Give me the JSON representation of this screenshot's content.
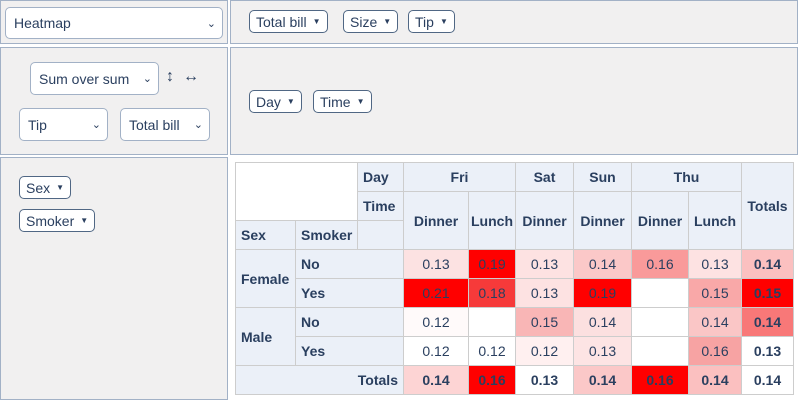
{
  "renderer": {
    "selected": "Heatmap"
  },
  "aggregator": {
    "selected": "Sum over sum",
    "arg1": "Tip",
    "arg2": "Total bill",
    "row_order_icon": "↕",
    "col_order_icon": "↔"
  },
  "unused_attrs": [
    "Total bill",
    "Size",
    "Tip"
  ],
  "col_attrs": [
    "Day",
    "Time"
  ],
  "row_attrs": [
    "Sex",
    "Smoker"
  ],
  "table": {
    "day_label": "Day",
    "time_label": "Time",
    "sex_label": "Sex",
    "smoker_label": "Smoker",
    "totals_label": "Totals",
    "days": [
      "Fri",
      "Sat",
      "Sun",
      "Thu"
    ],
    "times": [
      "Dinner",
      "Lunch",
      "Dinner",
      "Dinner",
      "Dinner",
      "Lunch"
    ],
    "sexes": [
      "Female",
      "Male"
    ],
    "smokers": [
      "No",
      "Yes",
      "No",
      "Yes"
    ],
    "rows": [
      {
        "values": [
          "0.13",
          "0.19",
          "0.13",
          "0.14",
          "0.16",
          "0.13"
        ],
        "total": "0.14"
      },
      {
        "values": [
          "0.21",
          "0.18",
          "0.13",
          "0.19",
          "",
          "0.15"
        ],
        "total": "0.15"
      },
      {
        "values": [
          "0.12",
          "",
          "0.15",
          "0.14",
          "",
          "0.14"
        ],
        "total": "0.14"
      },
      {
        "values": [
          "0.12",
          "0.12",
          "0.12",
          "0.13",
          "",
          "0.16"
        ],
        "total": "0.13"
      }
    ],
    "col_totals": [
      "0.14",
      "0.16",
      "0.13",
      "0.14",
      "0.16",
      "0.14"
    ],
    "grand_total": "0.14"
  },
  "heat": {
    "rows": [
      [
        "#fce2e2",
        "#ff0000",
        "#fde2e2",
        "#fbc8c8",
        "#f99a9a",
        "#fde2e2"
      ],
      [
        "#ff0000",
        "#f63a3a",
        "#fde2e2",
        "#ff0000",
        "#ffffff",
        "#f9a8a8"
      ],
      [
        "#fffafa",
        "#ffffff",
        "#f9b6b6",
        "#fce0e0",
        "#ffffff",
        "#fac6c6"
      ],
      [
        "#ffffff",
        "#ffffff",
        "#fff0f0",
        "#fde4e4",
        "#ffffff",
        "#f7a3a3"
      ]
    ],
    "row_totals": [
      "#fbc0c0",
      "#ff0000",
      "#f87878",
      "#ffffff"
    ],
    "col_totals": [
      "#fdd4d4",
      "#ff0000",
      "#ffffff",
      "#fbc8c8",
      "#ff0000",
      "#fbc0c0"
    ]
  }
}
